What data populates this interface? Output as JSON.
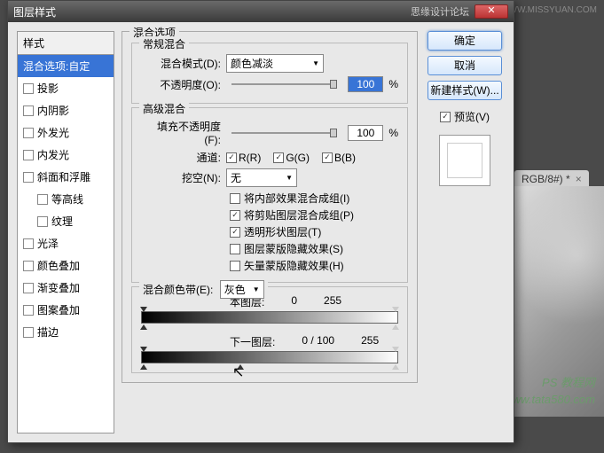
{
  "bg_url": "WWW.MISSYUAN.COM",
  "bg_tab": "RGB/8#) *",
  "bg_watermark1": "PS 教程网",
  "bg_watermark2": "www.tata580.com",
  "titlebar": {
    "title": "图层样式",
    "subtitle": "思缘设计论坛"
  },
  "left": {
    "header": "样式",
    "items": [
      {
        "label": "混合选项:自定",
        "selected": true,
        "checkbox": false
      },
      {
        "label": "投影",
        "checkbox": true,
        "checked": false
      },
      {
        "label": "内阴影",
        "checkbox": true,
        "checked": false
      },
      {
        "label": "外发光",
        "checkbox": true,
        "checked": false
      },
      {
        "label": "内发光",
        "checkbox": true,
        "checked": false
      },
      {
        "label": "斜面和浮雕",
        "checkbox": true,
        "checked": false
      },
      {
        "label": "等高线",
        "checkbox": true,
        "checked": false,
        "indent": true
      },
      {
        "label": "纹理",
        "checkbox": true,
        "checked": false,
        "indent": true
      },
      {
        "label": "光泽",
        "checkbox": true,
        "checked": false
      },
      {
        "label": "颜色叠加",
        "checkbox": true,
        "checked": false
      },
      {
        "label": "渐变叠加",
        "checkbox": true,
        "checked": false
      },
      {
        "label": "图案叠加",
        "checkbox": true,
        "checked": false
      },
      {
        "label": "描边",
        "checkbox": true,
        "checked": false
      }
    ]
  },
  "mid": {
    "title": "混合选项",
    "general": {
      "title": "常规混合",
      "mode_label": "混合模式(D):",
      "mode_value": "颜色减淡",
      "opacity_label": "不透明度(O):",
      "opacity_value": "100",
      "pct": "%"
    },
    "advanced": {
      "title": "高级混合",
      "fill_label": "填充不透明度(F):",
      "fill_value": "100",
      "pct": "%",
      "channel_label": "通道:",
      "ch_r": "R(R)",
      "ch_g": "G(G)",
      "ch_b": "B(B)",
      "knockout_label": "挖空(N):",
      "knockout_value": "无",
      "opts": [
        {
          "label": "将内部效果混合成组(I)",
          "on": false
        },
        {
          "label": "将剪贴图层混合成组(P)",
          "on": true
        },
        {
          "label": "透明形状图层(T)",
          "on": true
        },
        {
          "label": "图层蒙版隐藏效果(S)",
          "on": false
        },
        {
          "label": "矢量蒙版隐藏效果(H)",
          "on": false
        }
      ]
    },
    "blendif": {
      "title": "混合颜色带(E):",
      "value": "灰色",
      "this_label": "本图层:",
      "this_lo": "0",
      "this_hi": "255",
      "under_label": "下一图层:",
      "under_lo": "0",
      "under_mid": "100",
      "under_hi": "255",
      "sep": "/"
    }
  },
  "right": {
    "ok": "确定",
    "cancel": "取消",
    "newstyle": "新建样式(W)...",
    "preview": "预览(V)"
  }
}
